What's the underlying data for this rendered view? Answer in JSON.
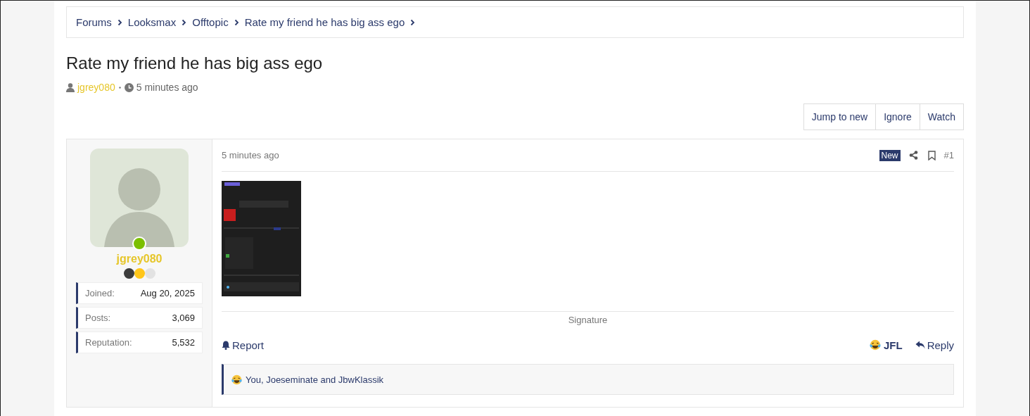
{
  "breadcrumbs": [
    "Forums",
    "Looksmax",
    "Offtopic",
    "Rate my friend he has big ass ego"
  ],
  "thread": {
    "title": "Rate my friend he has big ass ego",
    "author": "jgrey080",
    "time": "5 minutes ago"
  },
  "thread_actions": [
    "Jump to new",
    "Ignore",
    "Watch"
  ],
  "post": {
    "user": {
      "name": "jgrey080",
      "online": true,
      "rank_dots": [
        {
          "color": "#3c3c3c"
        },
        {
          "color": "#ffc61a"
        },
        {
          "color": "#e2e2e2"
        }
      ],
      "stats": [
        {
          "label": "Joined:",
          "value": "Aug 20, 2025"
        },
        {
          "label": "Posts:",
          "value": "3,069"
        },
        {
          "label": "Reputation:",
          "value": "5,532"
        }
      ]
    },
    "time": "5 minutes ago",
    "badge": "New",
    "number": "#1",
    "signature": "Signature",
    "report": "Report",
    "reaction": "JFL",
    "reply": "Reply",
    "reactions_summary": "You, Joeseminate and JbwKlassik"
  }
}
